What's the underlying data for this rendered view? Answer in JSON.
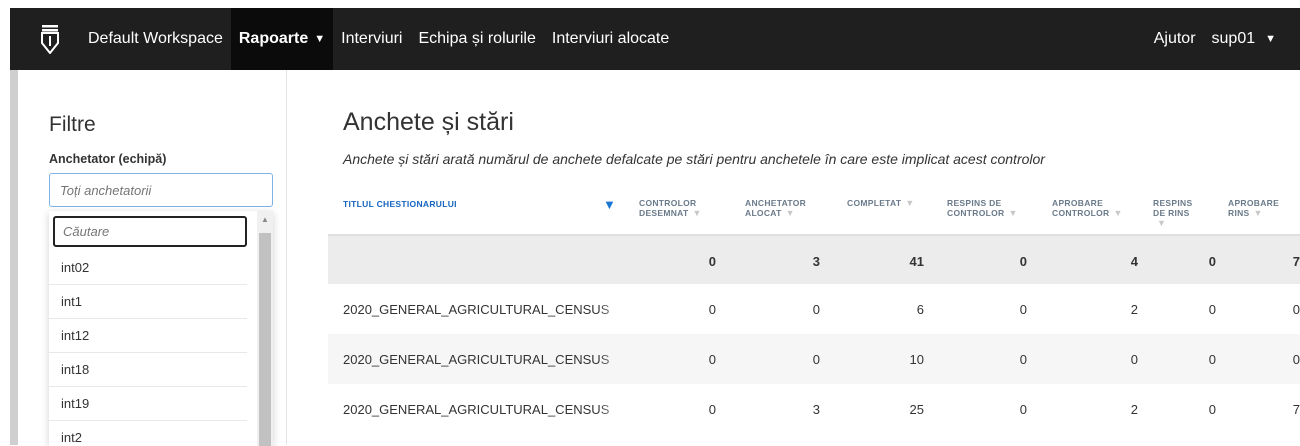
{
  "nav": {
    "workspace": "Default Workspace",
    "items": [
      {
        "label": "Rapoarte",
        "active": true,
        "has_caret": true
      },
      {
        "label": "Interviuri"
      },
      {
        "label": "Echipa și rolurile"
      },
      {
        "label": "Interviuri alocate"
      }
    ],
    "help": "Ajutor",
    "user": "sup01",
    "caret": "▼"
  },
  "sidebar": {
    "title": "Filtre",
    "filter_label": "Anchetator (echipă)",
    "filter_placeholder": "Toți anchetatorii",
    "dropdown": {
      "search_placeholder": "Căutare",
      "items": [
        "int02",
        "int1",
        "int12",
        "int18",
        "int19",
        "int2"
      ]
    }
  },
  "main": {
    "title": "Anchete și stări",
    "description": "Anchete și stări arată numărul de anchete defalcate pe stări pentru anchetele în care este implicat acest controlor",
    "columns": [
      {
        "label": "TITLUL CHESTIONARULUI"
      },
      {
        "label": "CONTROLOR DESEMNAT"
      },
      {
        "label": "ANCHETATOR ALOCAT"
      },
      {
        "label": "COMPLETAT"
      },
      {
        "label": "RESPINS DE CONTROLOR"
      },
      {
        "label": "APROBARE CONTROLOR"
      },
      {
        "label": "RESPINS DE RINS"
      },
      {
        "label": "APROBARE RINS"
      }
    ],
    "totals": [
      "0",
      "3",
      "41",
      "0",
      "4",
      "0",
      "7"
    ],
    "rows": [
      {
        "name": "2020_GENERAL_AGRICULTURAL_CENSUS",
        "values": [
          "0",
          "0",
          "6",
          "0",
          "2",
          "0",
          "0"
        ]
      },
      {
        "name": "2020_GENERAL_AGRICULTURAL_CENSUS",
        "values": [
          "0",
          "0",
          "10",
          "0",
          "0",
          "0",
          "0"
        ]
      },
      {
        "name": "2020_GENERAL_AGRICULTURAL_CENSUS",
        "values": [
          "0",
          "3",
          "25",
          "0",
          "2",
          "0",
          "7"
        ]
      }
    ]
  }
}
